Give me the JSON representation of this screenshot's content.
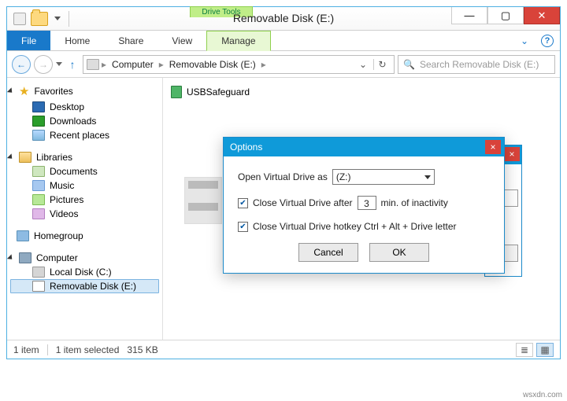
{
  "window": {
    "title": "Removable Disk (E:)",
    "context_label": "Drive Tools"
  },
  "ribbon": {
    "file": "File",
    "home": "Home",
    "share": "Share",
    "view": "View",
    "manage": "Manage"
  },
  "nav": {
    "segments": [
      "Computer",
      "Removable Disk (E:)"
    ],
    "search_placeholder": "Search Removable Disk (E:)"
  },
  "sidebar": {
    "favorites": {
      "label": "Favorites",
      "items": [
        "Desktop",
        "Downloads",
        "Recent places"
      ]
    },
    "libraries": {
      "label": "Libraries",
      "items": [
        "Documents",
        "Music",
        "Pictures",
        "Videos"
      ]
    },
    "homegroup": {
      "label": "Homegroup"
    },
    "computer": {
      "label": "Computer",
      "items": [
        "Local Disk (C:)",
        "Removable Disk (E:)"
      ]
    }
  },
  "content": {
    "items": [
      {
        "name": "USBSafeguard"
      }
    ]
  },
  "status": {
    "count": "1 item",
    "selection": "1 item selected",
    "size": "315 KB"
  },
  "options_dialog": {
    "title": "Options",
    "open_as_label": "Open Virtual Drive as",
    "open_as_value": "(Z:)",
    "close_after_checked": true,
    "close_after_label_pre": "Close Virtual Drive after",
    "close_after_minutes": "3",
    "close_after_label_post": "min. of inactivity",
    "hotkey_checked": true,
    "hotkey_label": "Close Virtual Drive hotkey Ctrl + Alt + Drive letter",
    "cancel": "Cancel",
    "ok": "OK"
  },
  "watermark": "wsxdn.com"
}
